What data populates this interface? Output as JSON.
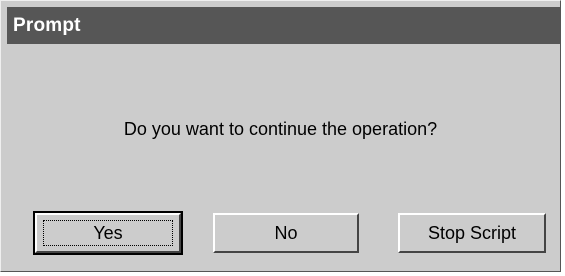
{
  "dialog": {
    "title": "Prompt",
    "message": "Do you want to continue the operation?",
    "buttons": {
      "yes": "Yes",
      "no": "No",
      "stop": "Stop Script"
    },
    "default_button": "Yes"
  }
}
